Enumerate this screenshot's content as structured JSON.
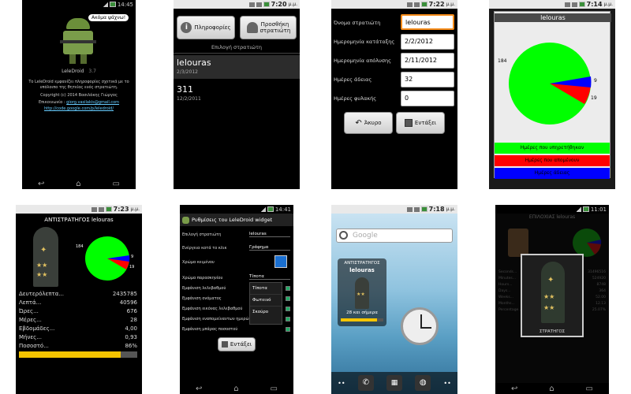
{
  "p1": {
    "time": "14:45",
    "bubble": "Ακόμα ψάχνω!",
    "app_name": "LeleDroid",
    "version": "3.7",
    "desc1": "Το LeleDroid εμφανίζει πληροφορίες σχετικά με το",
    "desc2": "υπόλοιπο της θητείας ενός στρατιώτη.",
    "copyright": "Copyright (c) 2014 Βασιλάκης Γιώργος",
    "contact_label": "Επικοινωνία :",
    "contact_email": "giorg.vasilakis@gmail.com",
    "link": "http://code.google.com/p/leledroid/"
  },
  "p2": {
    "time": "7:20",
    "time_suffix": "μ.μ.",
    "btn_info": "Πληροφορίες",
    "btn_add": "Προσθήκη στρατιώτη",
    "section": "Επιλογή στρατιώτη",
    "soldiers": [
      {
        "name": "lelouras",
        "date": "2/3/2012"
      },
      {
        "name": "311",
        "date": "12/2/2011"
      }
    ]
  },
  "p3": {
    "time": "7:22",
    "time_suffix": "μ.μ.",
    "fields": [
      {
        "label": "Όνομα στρατιώτη",
        "value": "lelouras"
      },
      {
        "label": "Ημερομηνία κατάταξης",
        "value": "2/2/2012"
      },
      {
        "label": "Ημερομηνία απόλυσης",
        "value": "2/11/2012"
      },
      {
        "label": "Ημέρες άδειας",
        "value": "32"
      },
      {
        "label": "Ημέρες φυλακής",
        "value": "0"
      }
    ],
    "btn_cancel": "Άκυρο",
    "btn_ok": "Εντάξει"
  },
  "p4": {
    "time": "7:14",
    "time_suffix": "μ.μ.",
    "title": "lelouras",
    "pie_labels": [
      "184",
      "9",
      "19"
    ],
    "legend": [
      "Ημέρες που υπηρετήθηκαν",
      "Ημέρες που απομένουν",
      "Ημέρες άδειας"
    ],
    "colors": {
      "served": "#00ff00",
      "remaining": "#ff0000",
      "leave": "#0000ff"
    }
  },
  "p5": {
    "time": "7:23",
    "time_suffix": "μ.μ.",
    "title": "ΑΝΤΙΣΤΡΑΤΗΓΟΣ lelouras",
    "pie_labels": [
      "184",
      "9",
      "19"
    ],
    "stats": [
      {
        "label": "Δευτερόλεπτα...",
        "value": "2435785"
      },
      {
        "label": "Λεπτά...",
        "value": "40596"
      },
      {
        "label": "Ώρες...",
        "value": "676"
      },
      {
        "label": "Μέρες...",
        "value": "28"
      },
      {
        "label": "Εβδομάδες...",
        "value": "4,00"
      },
      {
        "label": "Μήνες...",
        "value": "0,93"
      },
      {
        "label": "Ποσοστό...",
        "value": "86%"
      }
    ],
    "progress": 0.86
  },
  "p6": {
    "time": "14:41",
    "title": "Ρυθμίσεις του LeleDroid widget",
    "rows": [
      {
        "label": "Επιλογή στρατιώτη",
        "value": "lelouras"
      },
      {
        "label": "Ενέργεια κατά το κλικ",
        "value": "Γράφημα"
      },
      {
        "label": "Χρώμα κειμένου",
        "value": ""
      },
      {
        "label": "Χρώμα παρασκηνίου",
        "value": "Τίποτα"
      },
      {
        "label": "Εμφάνιση λελεβαθμού",
        "value": ""
      },
      {
        "label": "Εμφάνιση ονόματος",
        "value": ""
      },
      {
        "label": "Εμφάνιση εικόνας λελεβαθμού",
        "value": ""
      },
      {
        "label": "Εμφάνιση εναπομείναντων ημερών",
        "value": ""
      },
      {
        "label": "Εμφάνιση μπάρας ποσοστού",
        "value": ""
      }
    ],
    "dropdown": [
      "Τίποτα",
      "Φωτεινό",
      "Σκούρο"
    ],
    "btn_ok": "Εντάξει"
  },
  "p7": {
    "time": "7:18",
    "time_suffix": "μ.μ.",
    "search_placeholder": "Google",
    "widget_rank": "ΑΝΤΙΣΤΡΑΤΗΓΟΣ",
    "widget_name": "lelouras",
    "widget_days": "28 και σήμερα"
  },
  "p8": {
    "time": "11:01",
    "title": "ΕΠΙΛΟΧΙΑΣ lelouras",
    "stats": [
      {
        "label": "Seconds...",
        "value": "31496516"
      },
      {
        "label": "Minutes...",
        "value": "524920"
      },
      {
        "label": "Hours...",
        "value": "8748"
      },
      {
        "label": "Days...",
        "value": "364"
      },
      {
        "label": "Weeks...",
        "value": "52.00"
      },
      {
        "label": "Months...",
        "value": "12.13"
      },
      {
        "label": "Percentage...",
        "value": "25.07%"
      }
    ],
    "overlay_caption": "ΣΤΡΑΤΗΓΟΣ"
  }
}
